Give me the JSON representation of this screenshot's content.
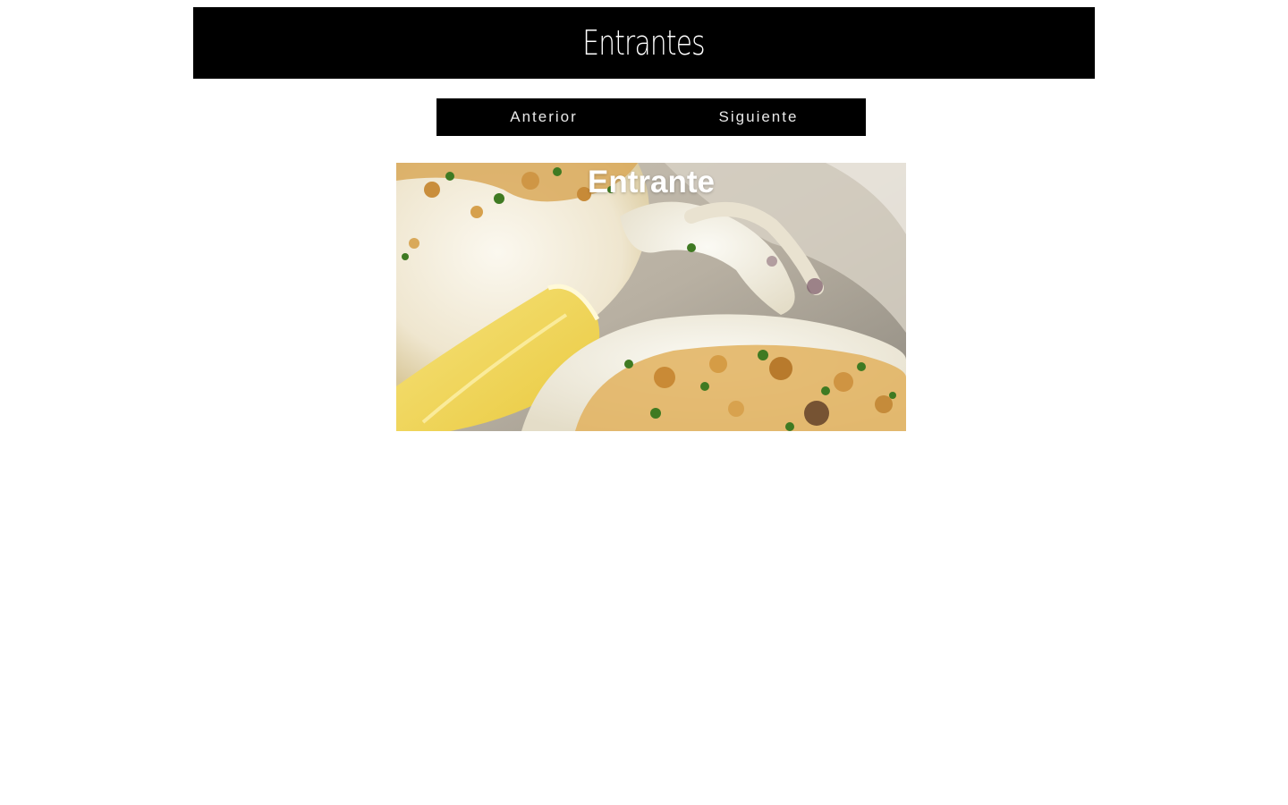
{
  "header": {
    "title": "Entrantes"
  },
  "pager": {
    "prev_label": "Anterior",
    "next_label": "Siguiente"
  },
  "card": {
    "caption": "Entrante",
    "image_alt": "grilled squid with garlic, parsley and lemon"
  },
  "colors": {
    "bar_background": "#000000",
    "bar_text": "#ffffff",
    "page_background": "#ffffff"
  }
}
